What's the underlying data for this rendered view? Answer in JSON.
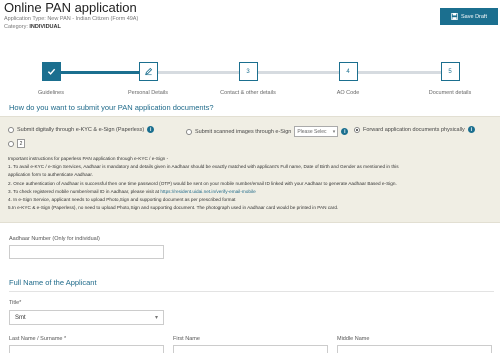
{
  "header": {
    "title": "Online PAN application",
    "application_type_label": "Application Type:",
    "application_type_value": "New PAN - Indian Citizen (Form 49A)",
    "category_label": "Category:",
    "category_value": "INDIVIDUAL",
    "save_draft_label": "Save Draft"
  },
  "stepper": {
    "steps": [
      {
        "number": "",
        "label": "Guidelines",
        "state": "done"
      },
      {
        "number": "",
        "label": "Personal Details",
        "state": "current"
      },
      {
        "number": "3",
        "label": "Contact & other details",
        "state": "todo"
      },
      {
        "number": "4",
        "label": "AO Code",
        "state": "todo"
      },
      {
        "number": "5",
        "label": "Document details",
        "state": "todo"
      }
    ]
  },
  "submit_section": {
    "question": "How do you want to submit your PAN application documents?",
    "options": [
      {
        "label": "Submit digitally through e-KYC & e-Sign (Paperless)",
        "selected": false
      },
      {
        "label": "Submit scanned images through e-Sign",
        "selected": false
      },
      {
        "label": "Forward application documents physically",
        "selected": true
      }
    ],
    "select_placeholder": "Please Selec",
    "number_box_value": "2",
    "instructions": [
      "Important instructions for paperless PAN application through e-KYC / e-Sign -",
      "1. To avail e-KYC / e-Sign Services, Aadhaar is mandatory and details given in Aadhaar should be exactly matched with applicant's Full name, Date of Birth and Gender as mentioned in this",
      "application form to authenticate Aadhaar.",
      "2. Once authentication of Aadhaar is successful then one time password (OTP) would be sent on your mobile number/email ID linked with your Aadhaar to generate Aadhaar Based e-Sign.",
      "3. To check registered mobile number/email ID in Aadhaar, please visit at",
      "4. In e-Sign Service, applicant needs to upload Photo,Sign and supporting document as per prescribed format",
      "5.In e-KYC & e-Sign (Paperless), no need to upload Photo,Sign and supporting document. The photograph used in Aadhaar card would be printed in PAN card."
    ],
    "instructions_link": "https://resident.uidai.net.in/verify-email-mobile"
  },
  "aadhaar": {
    "label": "Aadhaar Number (Only for individual)",
    "value": ""
  },
  "full_name": {
    "heading": "Full Name of the Applicant",
    "title_label": "Title*",
    "title_value": "Smt",
    "last_name_label": "Last Name / Surname *",
    "first_name_label": "First Name",
    "middle_name_label": "Middle Name",
    "last_name_value": "",
    "first_name_value": "",
    "middle_name_value": ""
  },
  "colors": {
    "primary": "#1b6f8f",
    "panel_bg": "#f0eee4",
    "heading": "#1f6a8a"
  },
  "icons": {
    "save": "floppy-disk-icon",
    "step_done": "checkmark-icon",
    "step_current": "pencil-icon",
    "info": "info-icon"
  }
}
